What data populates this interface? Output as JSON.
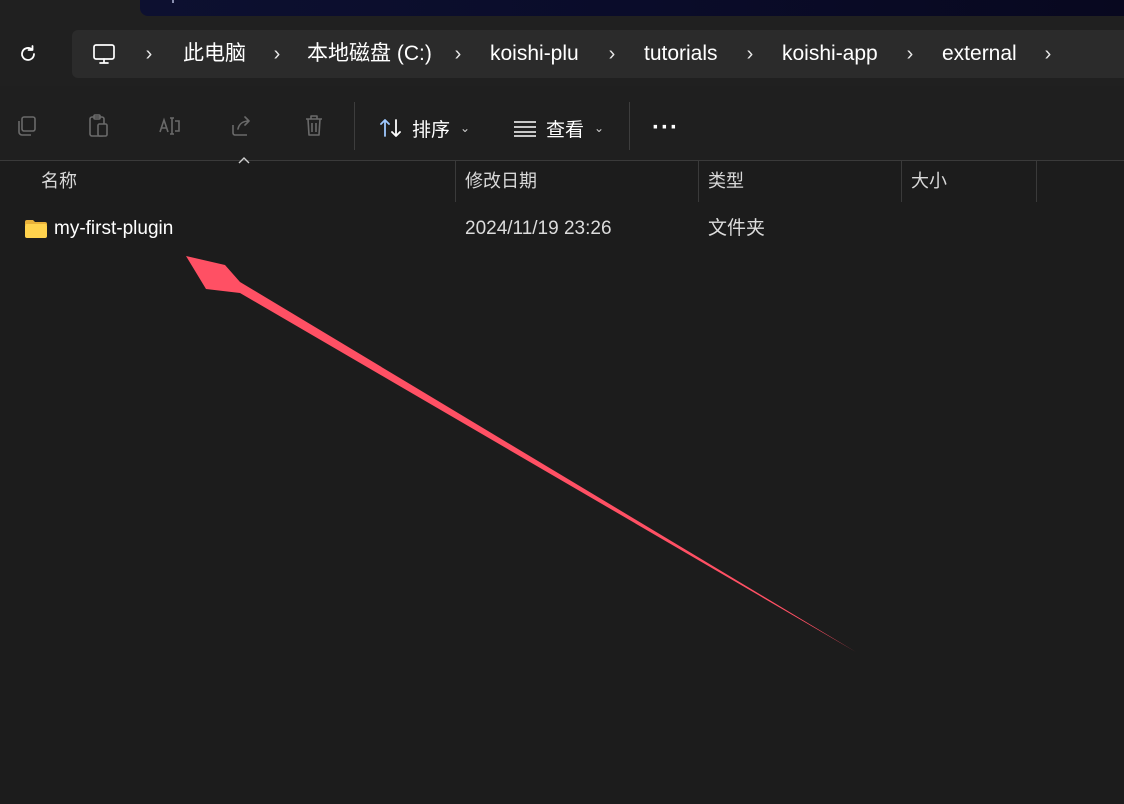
{
  "window": {
    "accent_annotation_color": "#ff5064"
  },
  "address_bar": {
    "refresh_icon": "refresh-icon",
    "root_icon": "this-pc-icon",
    "breadcrumbs": [
      "此电脑",
      "本地磁盘 (C:)",
      "koishi-plu",
      "tutorials",
      "koishi-app",
      "external"
    ]
  },
  "toolbar": {
    "icons": [
      "copy-icon",
      "paste-icon",
      "rename-icon",
      "share-icon",
      "delete-icon"
    ],
    "sort_label": "排序",
    "view_label": "查看",
    "more_label": "···"
  },
  "columns": {
    "name": "名称",
    "modified": "修改日期",
    "type": "类型",
    "size": "大小"
  },
  "files": [
    {
      "name": "my-first-plugin",
      "modified": "2024/11/19 23:26",
      "type": "文件夹",
      "size": ""
    }
  ]
}
